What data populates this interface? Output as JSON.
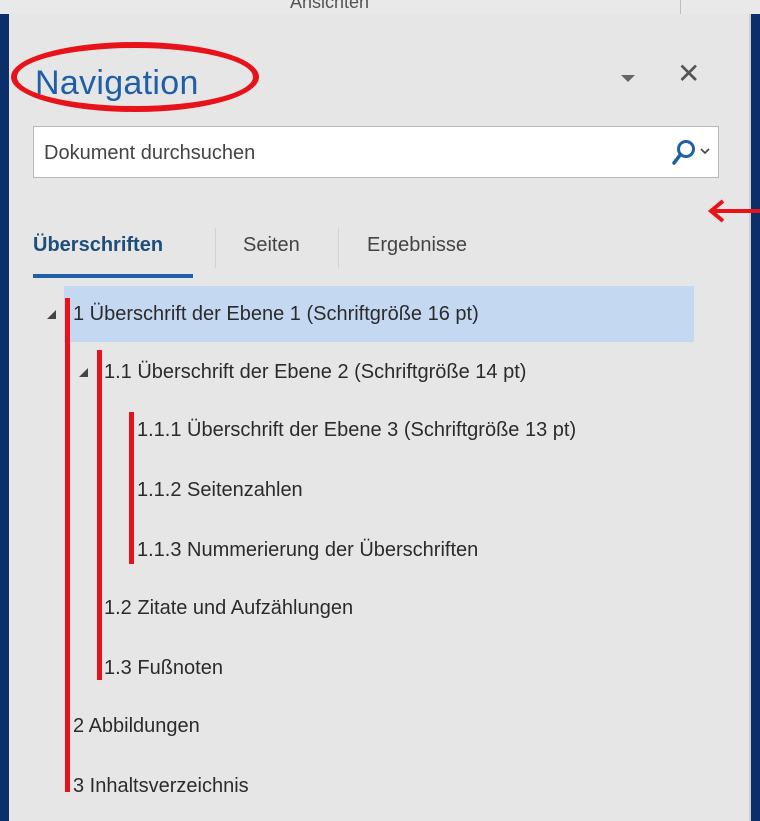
{
  "ribbon": {
    "group_label": "Ansichten"
  },
  "pane": {
    "title": "Navigation",
    "menu_icon": "triangle-down-icon",
    "close_icon": "close-icon",
    "close_glyph": "✕"
  },
  "search": {
    "placeholder": "Dokument durchsuchen",
    "value": "",
    "icon": "search-icon",
    "dropdown_icon": "chevron-down-icon"
  },
  "tabs": [
    {
      "label": "Überschriften",
      "active": true
    },
    {
      "label": "Seiten",
      "active": false
    },
    {
      "label": "Ergebnisse",
      "active": false
    }
  ],
  "headings": [
    {
      "label": "1 Überschrift der Ebene 1 (Schriftgröße 16 pt)",
      "level": 1,
      "expanded": true,
      "selected": true
    },
    {
      "label": "1.1 Überschrift der Ebene 2 (Schriftgröße 14 pt)",
      "level": 2,
      "expanded": true,
      "selected": false
    },
    {
      "label": "1.1.1 Überschrift der Ebene 3 (Schriftgröße 13 pt)",
      "level": 3,
      "selected": false
    },
    {
      "label": "1.1.2 Seitenzahlen",
      "level": 3,
      "selected": false
    },
    {
      "label": "1.1.3 Nummerierung der Überschriften",
      "level": 3,
      "selected": false
    },
    {
      "label": "1.2 Zitate und Aufzählungen",
      "level": 2,
      "selected": false
    },
    {
      "label": "1.3 Fußnoten",
      "level": 2,
      "selected": false
    },
    {
      "label": "2 Abbildungen",
      "level": 1,
      "selected": false
    },
    {
      "label": "3 Inhaltsverzeichnis",
      "level": 1,
      "selected": false
    }
  ],
  "colors": {
    "accent": "#1f5fa8",
    "selection": "#c4d8f2",
    "annotation_red": "#e8121a",
    "frame_blue": "#0a2f6b"
  }
}
